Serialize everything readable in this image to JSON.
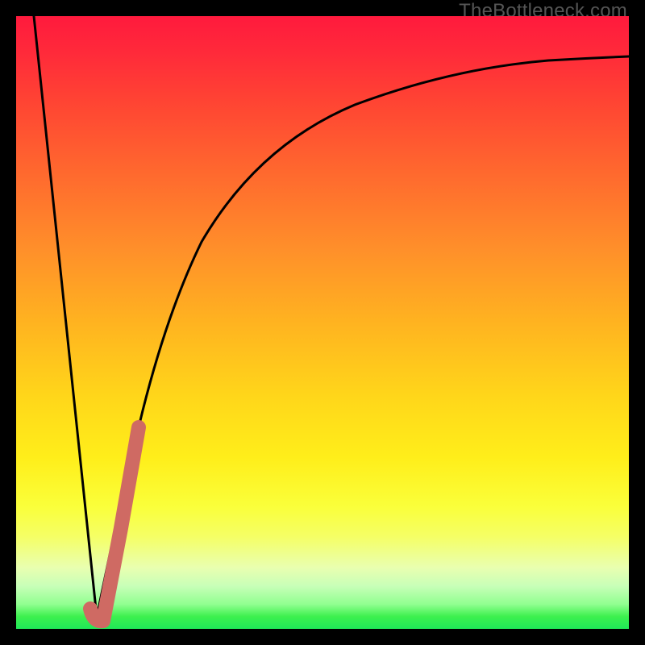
{
  "watermark": "TheBottleneck.com",
  "chart_data": {
    "type": "line",
    "title": "",
    "xlabel": "",
    "ylabel": "",
    "xlim": [
      0,
      100
    ],
    "ylim": [
      0,
      100
    ],
    "grid": false,
    "legend": false,
    "series": [
      {
        "name": "left-segment",
        "color": "#000000",
        "x": [
          3,
          13
        ],
        "y": [
          100,
          2
        ]
      },
      {
        "name": "main-curve",
        "color": "#000000",
        "x": [
          13,
          16,
          19,
          22,
          25,
          28,
          32,
          38,
          45,
          55,
          70,
          85,
          100
        ],
        "y": [
          2,
          15,
          28,
          40,
          50,
          58,
          66,
          74,
          80,
          85,
          89,
          91.5,
          93
        ]
      },
      {
        "name": "highlight-segment",
        "color": "#cf6a63",
        "x": [
          12,
          13,
          14,
          17,
          20
        ],
        "y": [
          3,
          2,
          3,
          18,
          33
        ]
      }
    ]
  }
}
